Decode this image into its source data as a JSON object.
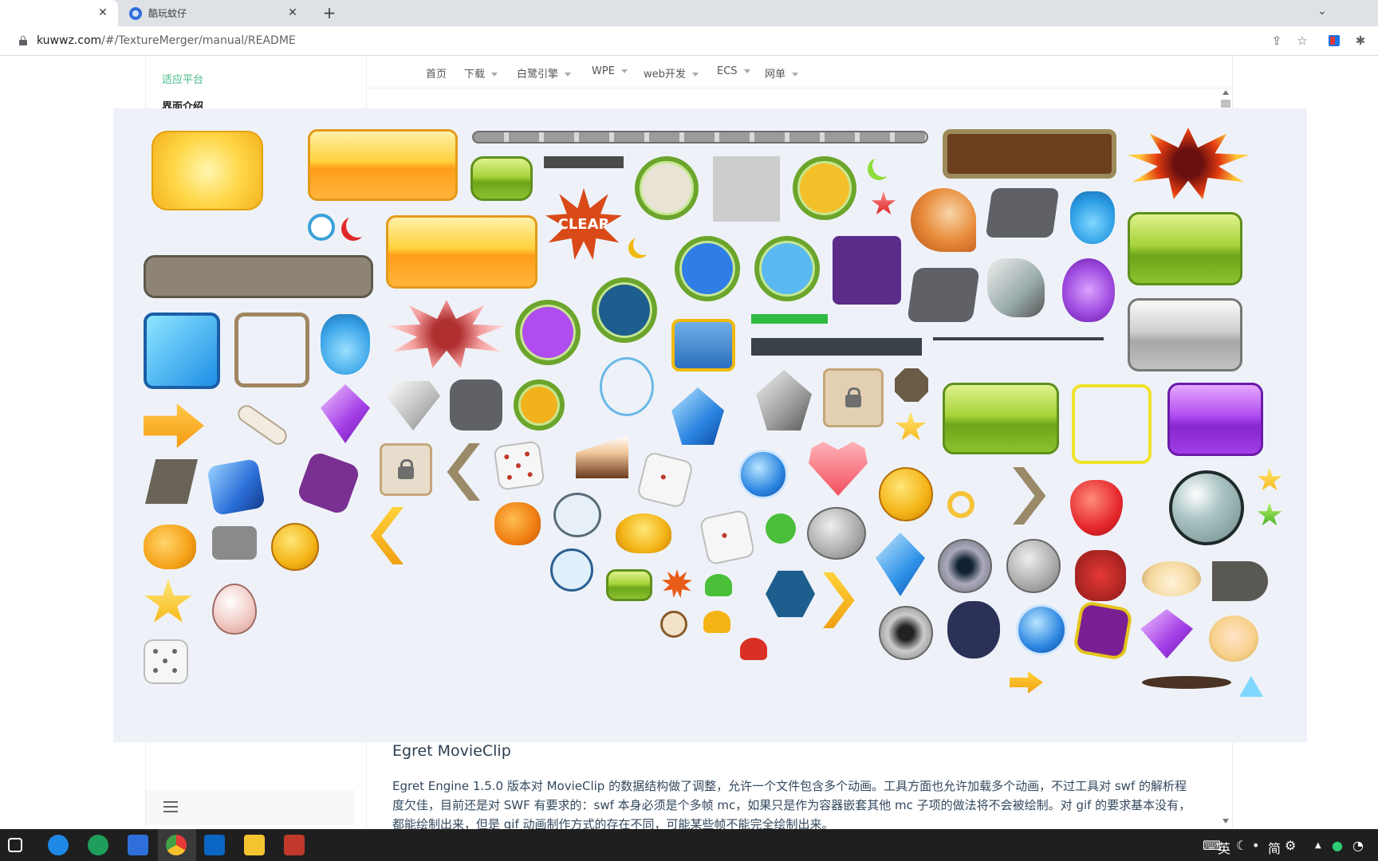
{
  "browser": {
    "tabs": [
      {
        "title": "",
        "active": true
      },
      {
        "title": "酷玩蚊仔",
        "active": false
      }
    ],
    "url_host": "kuwwz.com",
    "url_path": "/#/TextureMerger/manual/README"
  },
  "sidebar": {
    "items": [
      {
        "label": "适应平台"
      },
      {
        "label": "界面介绍"
      }
    ]
  },
  "nav": {
    "items": [
      {
        "label": "首页"
      },
      {
        "label": "下载"
      },
      {
        "label": "白鹭引擎"
      },
      {
        "label": "WPE"
      },
      {
        "label": "web开发"
      },
      {
        "label": "ECS"
      },
      {
        "label": "网单"
      }
    ]
  },
  "content": {
    "heading": "Egret MovieClip",
    "paragraph": "Egret Engine 1.5.0 版本对 MovieClip 的数据结构做了调整，允许一个文件包含多个动画。工具方面也允许加载多个动画，不过工具对 swf 的解析程度欠佳，目前还是对 SWF 有要求的：swf 本身必须是个多帧 mc，如果只是作为容器嵌套其他 mc 子项的做法将不会被绘制。对 gif 的要求基本没有，都能绘制出来，但是 gif 动画制作方式的存在不同，可能某些帧不能完全绘制出来。"
  },
  "overlay": {
    "clear_badge": "CLEAR"
  },
  "taskbar": {
    "tray_text": [
      "英",
      "简"
    ]
  }
}
